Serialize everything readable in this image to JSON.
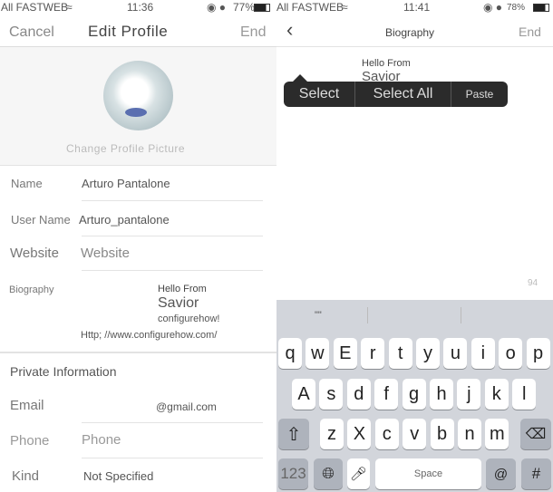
{
  "left": {
    "status": {
      "carrier": "All FASTWEB",
      "time": "11:36",
      "battery": "77%"
    },
    "nav": {
      "cancel": "Cancel",
      "title": "Edit Profile",
      "done": "End"
    },
    "change_photo": "Change Profile Picture",
    "fields": [
      {
        "label": "Name",
        "value": "Arturo Pantalone"
      },
      {
        "label": "User Name",
        "value": "Arturo_pantalone"
      },
      {
        "label": "Website",
        "value": "Website"
      }
    ],
    "bio": {
      "label": "Biography",
      "line1": "Hello From",
      "line2": "Savior",
      "line3": "configurehow!",
      "url": "Http; //www.configurehow.com/"
    },
    "private_header": "Private Information",
    "private": [
      {
        "label": "Email",
        "value": "@gmail.com"
      },
      {
        "label": "Phone",
        "value": "Phone"
      },
      {
        "label": "Kind",
        "value": "Not Specified"
      }
    ]
  },
  "right": {
    "status": {
      "carrier": "All FASTWEB",
      "time": "11:41",
      "battery": "78%"
    },
    "nav": {
      "title": "Biography",
      "done": "End"
    },
    "text": {
      "line1": "Hello From",
      "line2": "Savior"
    },
    "menu": [
      "Select",
      "Select All",
      "Paste"
    ],
    "counter": "94",
    "keyboard": {
      "suggestion": "\"\"",
      "row1": [
        "q",
        "w",
        "E",
        "r",
        "t",
        "y",
        "u",
        "i",
        "o",
        "p"
      ],
      "row2": [
        "A",
        "s",
        "d",
        "f",
        "g",
        "h",
        "j",
        "k",
        "l"
      ],
      "row3": [
        "z",
        "X",
        "c",
        "v",
        "b",
        "n",
        "m"
      ],
      "num": "123",
      "space": "Space",
      "hash": "#"
    }
  }
}
